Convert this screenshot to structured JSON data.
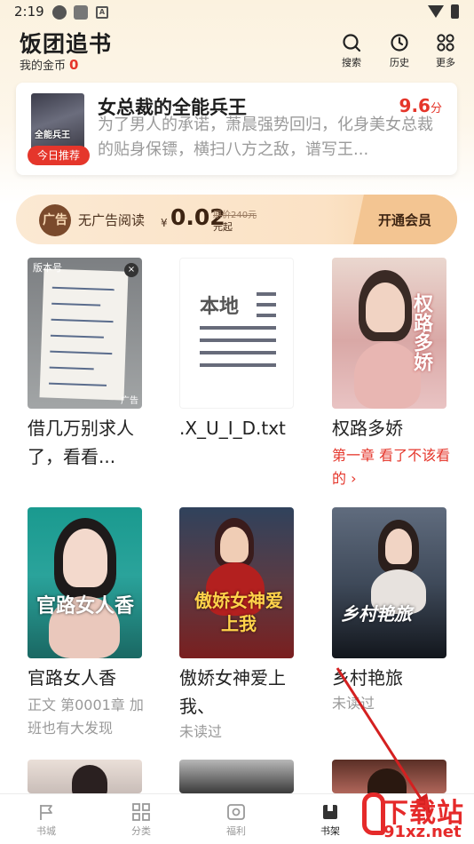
{
  "status_bar": {
    "time": "2:19",
    "app_badge": "A"
  },
  "header": {
    "title": "饭团追书",
    "coins_label": "我的金币",
    "coins_value": "0",
    "actions": [
      {
        "label": "搜索",
        "icon": "search-icon"
      },
      {
        "label": "历史",
        "icon": "clock-icon"
      },
      {
        "label": "更多",
        "icon": "grid-icon"
      }
    ]
  },
  "featured": {
    "badge": "今日推荐",
    "cover_text": "全能兵王",
    "title": "女总裁的全能兵王",
    "score": "9.6",
    "score_unit": "分",
    "description": "为了男人的承诺，萧晨强势回归，化身美女总裁的贴身保镖，横扫八方之敌，谱写王..."
  },
  "vip": {
    "logo_text": "广告",
    "label": "无广告阅读",
    "currency": "¥",
    "price": "0.02",
    "original_price": "原价240元",
    "unit": "元起",
    "cta": "开通会员"
  },
  "books": [
    {
      "name": "借几万别求人了，看看...",
      "sub": "",
      "cover_top": "版本号",
      "ad_label": "广告",
      "close": "×"
    },
    {
      "name": ".X_U_I_D.txt",
      "sub": "",
      "cover_top": "本地"
    },
    {
      "name": "权路多娇",
      "sub": "第一章 看了不该看的 ›",
      "sub_style": "red",
      "cover_title": "权路多娇"
    },
    {
      "name": "官路女人香",
      "sub": "正文 第0001章 加班也有大发现",
      "sub_style": "gray",
      "cover_title": "官路女人香"
    },
    {
      "name": "傲娇女神爱上我、",
      "sub": "未读过",
      "sub_style": "gray",
      "cover_title": "傲娇女神爱上我"
    },
    {
      "name": "乡村艳旅",
      "sub": "未读过",
      "sub_style": "gray",
      "cover_title": "乡村艳旅"
    }
  ],
  "nav": [
    {
      "label": "书城",
      "icon": "flag-icon"
    },
    {
      "label": "分类",
      "icon": "category-icon"
    },
    {
      "label": "福利",
      "icon": "gift-icon"
    },
    {
      "label": "书架",
      "icon": "bookshelf-icon",
      "active": true
    }
  ],
  "watermark": {
    "line1": "下载站",
    "line2": "91xz.net"
  },
  "colors": {
    "accent": "#e5362b",
    "vip_dark": "#3d2412"
  }
}
